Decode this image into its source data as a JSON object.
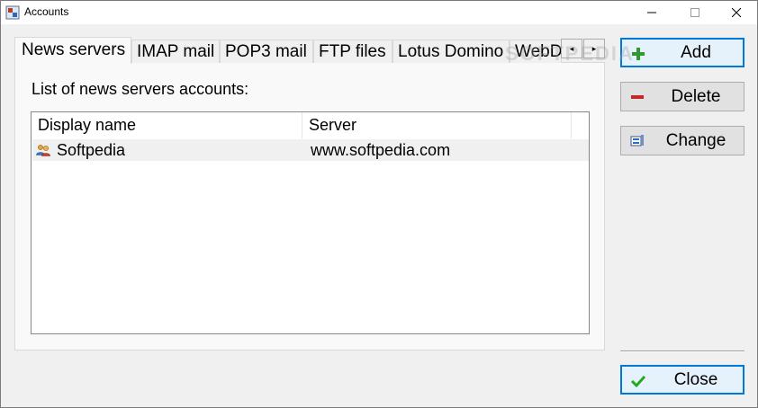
{
  "window": {
    "title": "Accounts",
    "minimize_glyph": "—",
    "maximize_glyph": "☐",
    "close_glyph": "✕"
  },
  "tabs": [
    {
      "label": "News servers",
      "active": true
    },
    {
      "label": "IMAP mail",
      "active": false
    },
    {
      "label": "POP3 mail",
      "active": false
    },
    {
      "label": "FTP files",
      "active": false
    },
    {
      "label": "Lotus Domino",
      "active": false
    },
    {
      "label": "WebD",
      "active": false
    }
  ],
  "tab_scroll": {
    "left_glyph": "◂",
    "right_glyph": "▸"
  },
  "list": {
    "label": "List of news servers accounts:",
    "columns": [
      "Display name",
      "Server"
    ],
    "rows": [
      {
        "display_name": "Softpedia",
        "server": "www.softpedia.com",
        "icon": "users-icon"
      }
    ]
  },
  "buttons": {
    "add": "Add",
    "delete": "Delete",
    "change": "Change",
    "close": "Close"
  },
  "watermark": "SOFTPEDIA",
  "colors": {
    "accent": "#0078d7",
    "add_icon": "#2e9a2e",
    "delete_icon": "#c62828",
    "close_icon": "#22a822"
  }
}
